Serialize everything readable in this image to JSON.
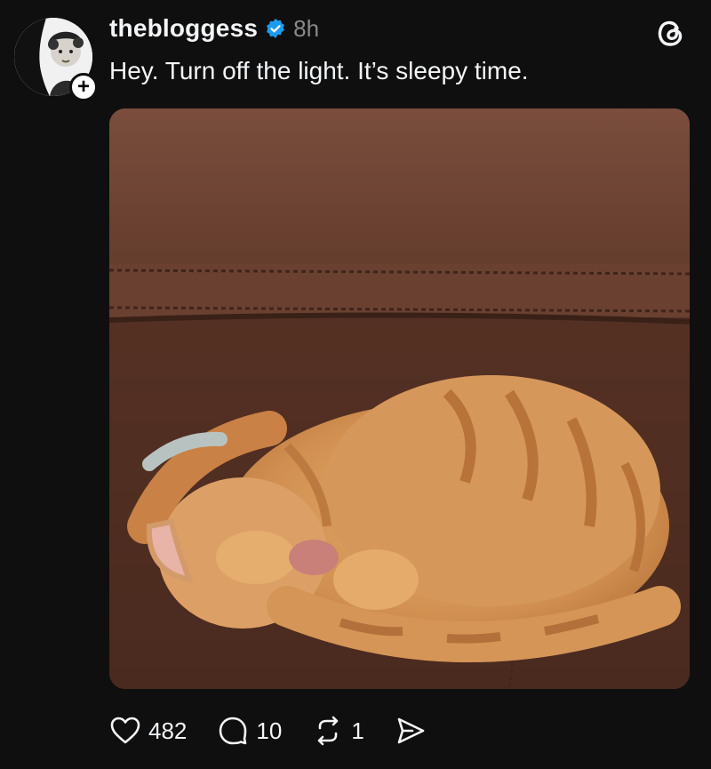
{
  "post": {
    "username": "thebloggess",
    "time": "8h",
    "text": "Hey. Turn off the light. It’s sleepy time.",
    "verified": true,
    "follow_badge": "+"
  },
  "photo": {
    "icon": "sleeping-cat-photo"
  },
  "actions": {
    "likes": "482",
    "replies": "10",
    "reposts": "1"
  },
  "colors": {
    "background": "#0f0f10",
    "verified": "#1d9bf0",
    "text": "#f3f5f7",
    "muted": "#8a8a8a"
  }
}
